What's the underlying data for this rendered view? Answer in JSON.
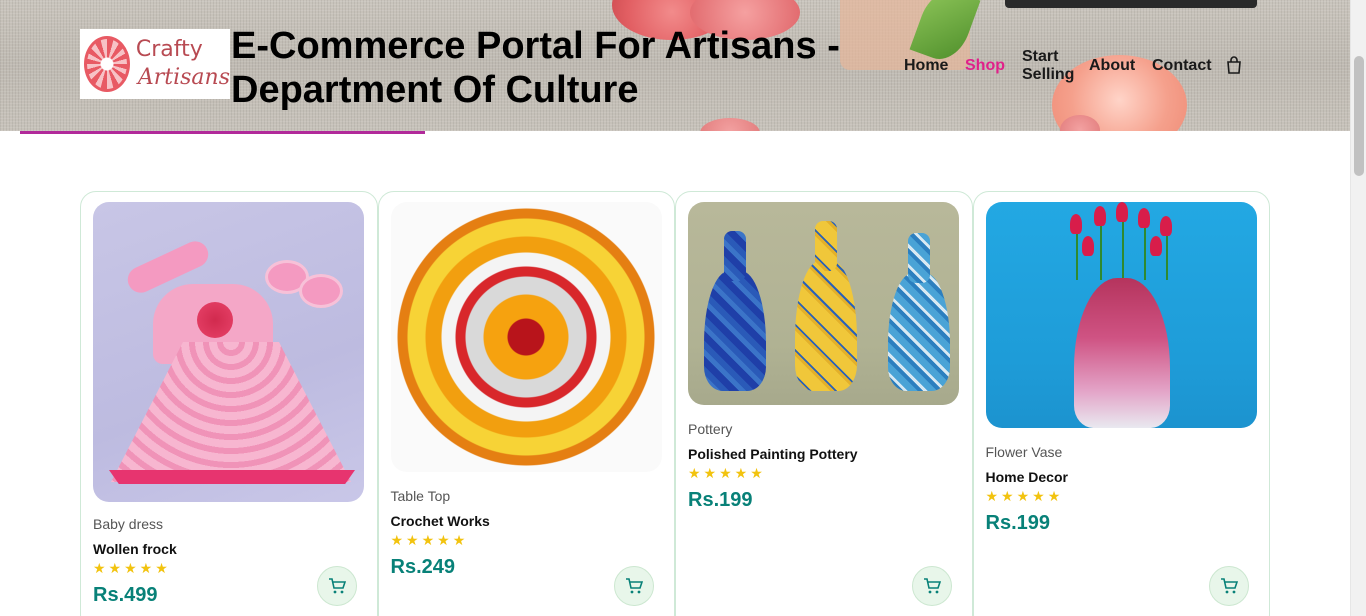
{
  "header": {
    "logo": {
      "line1": "Crafty",
      "line2": "Artisans"
    },
    "title": "E-Commerce Portal For Artisans - Department Of Culture",
    "nav": {
      "home": "Home",
      "shop": "Shop",
      "start_selling": "Start Selling",
      "about": "About",
      "contact": "Contact",
      "cart_icon": "shopping-bag-icon"
    },
    "active_color": "#e0218a"
  },
  "products": [
    {
      "category": "Baby dress",
      "name": "Wollen frock",
      "stars": "★★★★★",
      "price": "Rs.499",
      "image": "pink crochet baby frock with booties"
    },
    {
      "category": "Table Top",
      "name": "Crochet Works",
      "stars": "★★★★★",
      "price": "Rs.249",
      "image": "round crochet doily with sunflower center"
    },
    {
      "category": "Pottery",
      "name": "Polished Painting Pottery",
      "stars": "★★★★★",
      "price": "Rs.199",
      "image": "three painted blue and yellow vases"
    },
    {
      "category": "Flower Vase",
      "name": "Home Decor",
      "stars": "★★★★★",
      "price": "Rs.199",
      "image": "pink decorated vase with red tulips"
    }
  ],
  "colors": {
    "price": "#088178",
    "star": "#f2c30f",
    "card_border": "#cfe9d7",
    "accent_line": "#b12a9a"
  }
}
